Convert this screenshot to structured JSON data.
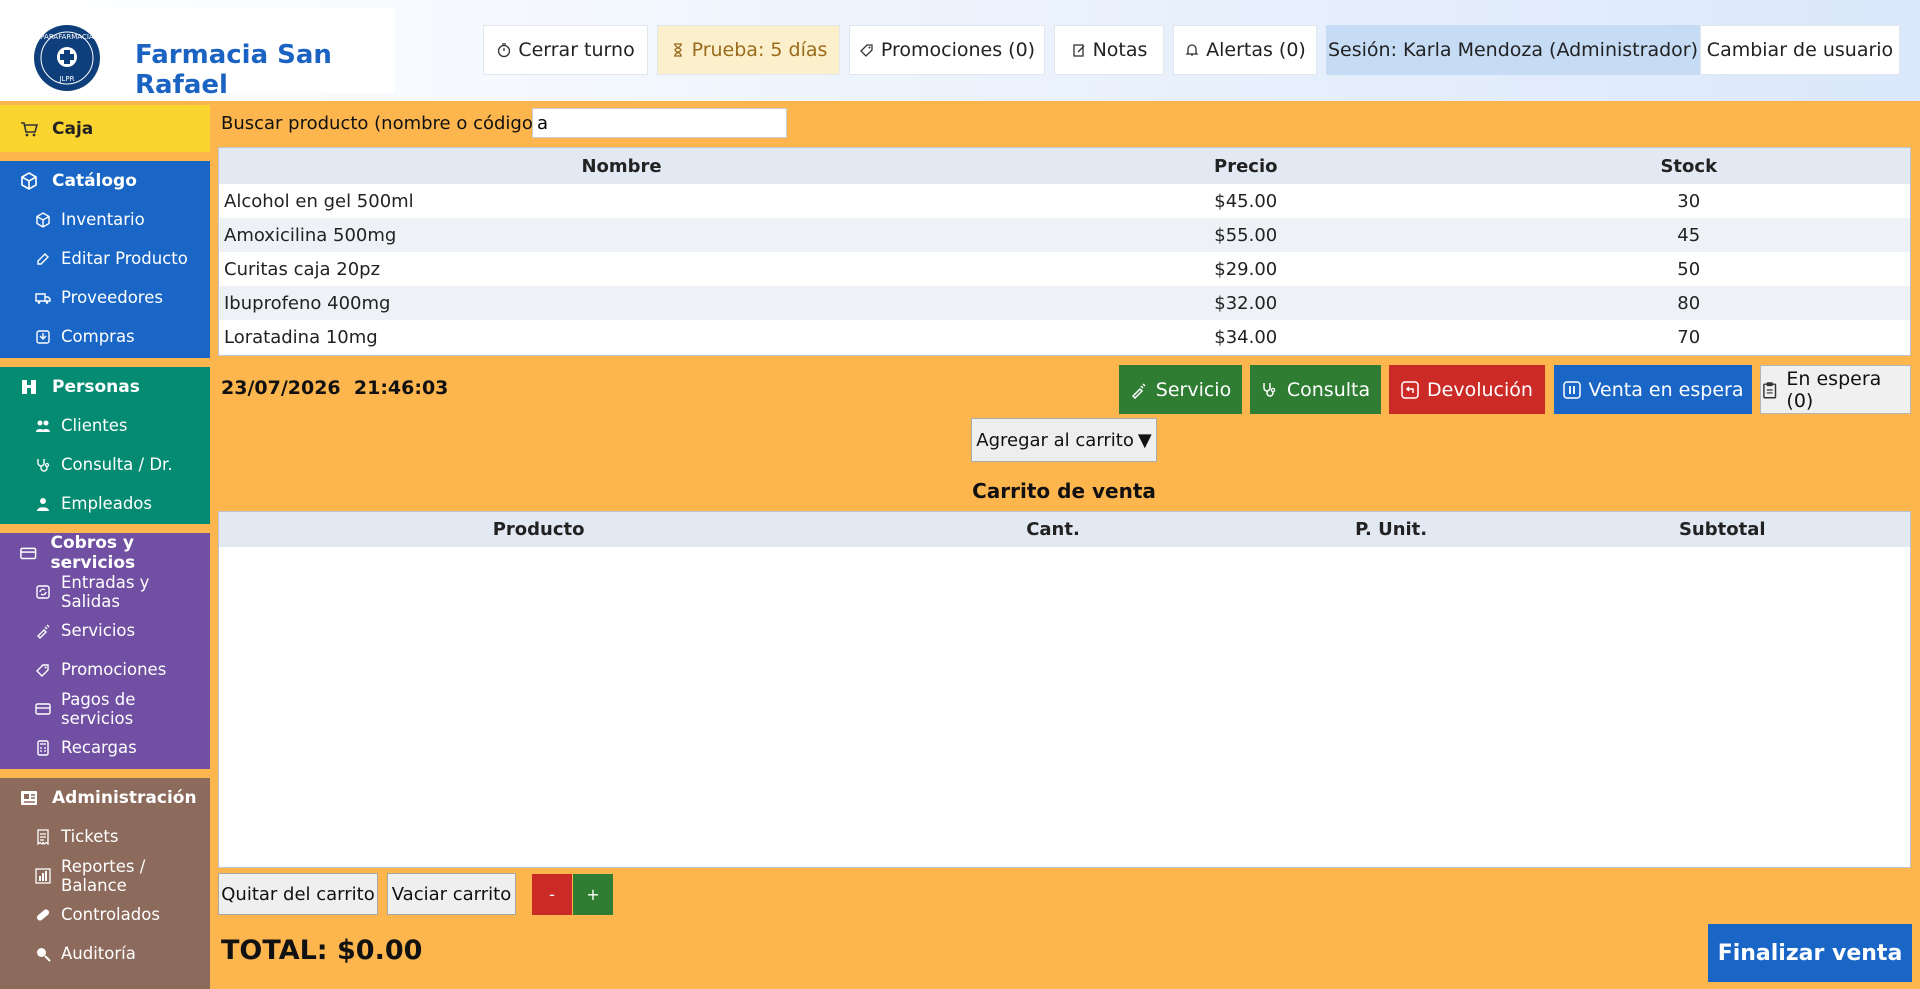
{
  "app": {
    "brand": "Farmacia San Rafael",
    "logo_text_top": "PARAFARMACIA",
    "logo_text_bottom": "JLPR"
  },
  "header": {
    "close_shift": "Cerrar turno",
    "trial": "Prueba: 5 días",
    "promotions": "Promociones (0)",
    "notes": "Notas",
    "alerts": "Alertas (0)",
    "session": "Sesión: Karla Mendoza (Administrador)",
    "change_user": "Cambiar de usuario"
  },
  "sidebar": {
    "caja": "Caja",
    "catalogo": {
      "title": "Catálogo",
      "items": [
        "Inventario",
        "Editar Producto",
        "Proveedores",
        "Compras"
      ]
    },
    "personas": {
      "title": "Personas",
      "items": [
        "Clientes",
        "Consulta / Dr.",
        "Empleados"
      ]
    },
    "cobros": {
      "title": "Cobros y servicios",
      "items": [
        "Entradas y Salidas",
        "Servicios",
        "Promociones",
        "Pagos de servicios",
        "Recargas"
      ]
    },
    "admin": {
      "title": "Administración",
      "items": [
        "Tickets",
        "Reportes / Balance",
        "Controlados",
        "Auditoría"
      ]
    }
  },
  "search": {
    "label": "Buscar producto (nombre o código):",
    "value": "a"
  },
  "products": {
    "headers": {
      "name": "Nombre",
      "price": "Precio",
      "stock": "Stock"
    },
    "rows": [
      {
        "name": "Alcohol en gel 500ml",
        "price": "$45.00",
        "stock": "30"
      },
      {
        "name": "Amoxicilina 500mg",
        "price": "$55.00",
        "stock": "45"
      },
      {
        "name": "Curitas caja 20pz",
        "price": "$29.00",
        "stock": "50"
      },
      {
        "name": "Ibuprofeno 400mg",
        "price": "$32.00",
        "stock": "80"
      },
      {
        "name": "Loratadina 10mg",
        "price": "$34.00",
        "stock": "70"
      }
    ]
  },
  "datetime": {
    "date": "23/07/2026",
    "time": "21:46:03"
  },
  "actions": {
    "service": "Servicio",
    "consult": "Consulta",
    "return": "Devolución",
    "hold": "Venta en espera",
    "on_hold": "En espera (0)"
  },
  "cart": {
    "add_label": "Agregar al carrito",
    "title": "Carrito de venta",
    "headers": {
      "product": "Producto",
      "qty": "Cant.",
      "unit": "P. Unit.",
      "subtotal": "Subtotal"
    },
    "remove": "Quitar del carrito",
    "empty": "Vaciar carrito",
    "minus": "-",
    "plus": "+"
  },
  "total": "TOTAL: $0.00",
  "finalize": "Finalizar venta",
  "colors": {
    "main_bg": "#fdb54e",
    "caja": "#fbd52f",
    "catalogo": "#1966c6",
    "personas": "#048b72",
    "cobros": "#7150a3",
    "admin": "#8c6a5c",
    "green": "#2e7d32",
    "red": "#cc2a27",
    "blue": "#1a66c7"
  }
}
